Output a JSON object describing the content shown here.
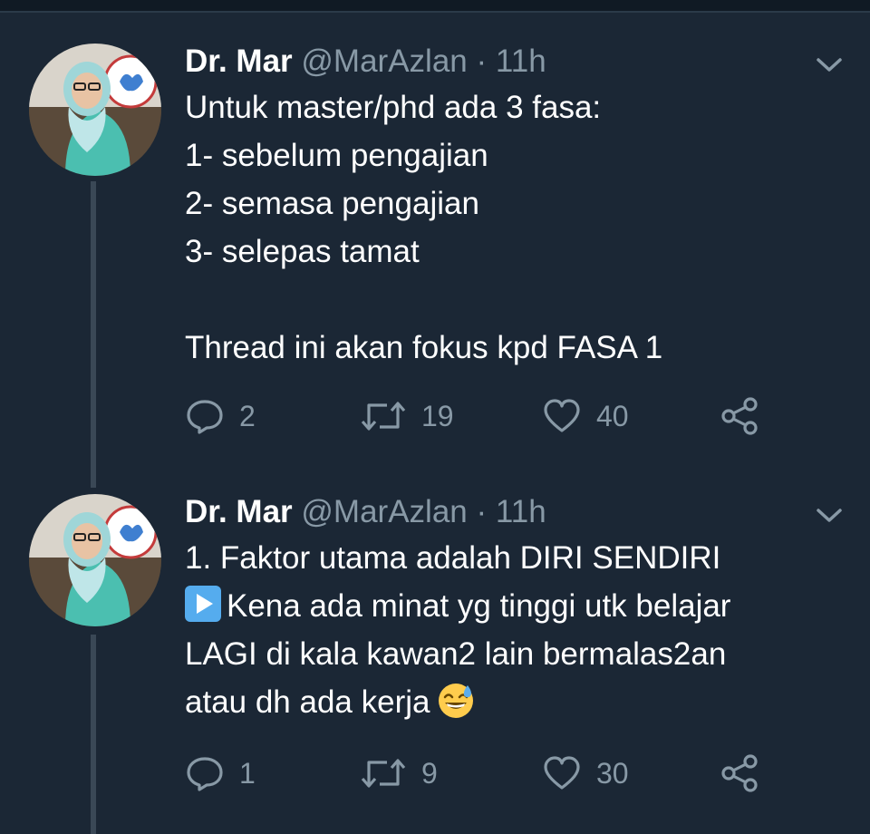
{
  "tweets": [
    {
      "author": {
        "name": "Dr. Mar",
        "handle": "@MarAzlan",
        "separator": "·",
        "time": "11h"
      },
      "text": "Untuk master/phd ada 3 fasa:\n1- sebelum pengajian\n2- semasa pengajian\n3- selepas tamat\n\nThread ini akan fokus kpd FASA 1",
      "actions": {
        "replies": "2",
        "retweets": "19",
        "likes": "40"
      }
    },
    {
      "author": {
        "name": "Dr. Mar",
        "handle": "@MarAzlan",
        "separator": "·",
        "time": "11h"
      },
      "line1": "1. Faktor utama adalah DIRI SENDIRI",
      "line2_icon": "play-button-emoji",
      "line2": "Kena ada minat yg tinggi utk belajar",
      "line3": "LAGI di kala kawan2 lain bermalas2an",
      "line4": "atau dh ada kerja",
      "line4_emoji": "grinning-sweat-emoji",
      "actions": {
        "replies": "1",
        "retweets": "9",
        "likes": "30"
      }
    }
  ],
  "colors": {
    "background": "#1b2735",
    "text": "#ffffff",
    "secondary": "#8899a6",
    "thread_line": "#3a4856",
    "play_icon": "#55acee"
  }
}
